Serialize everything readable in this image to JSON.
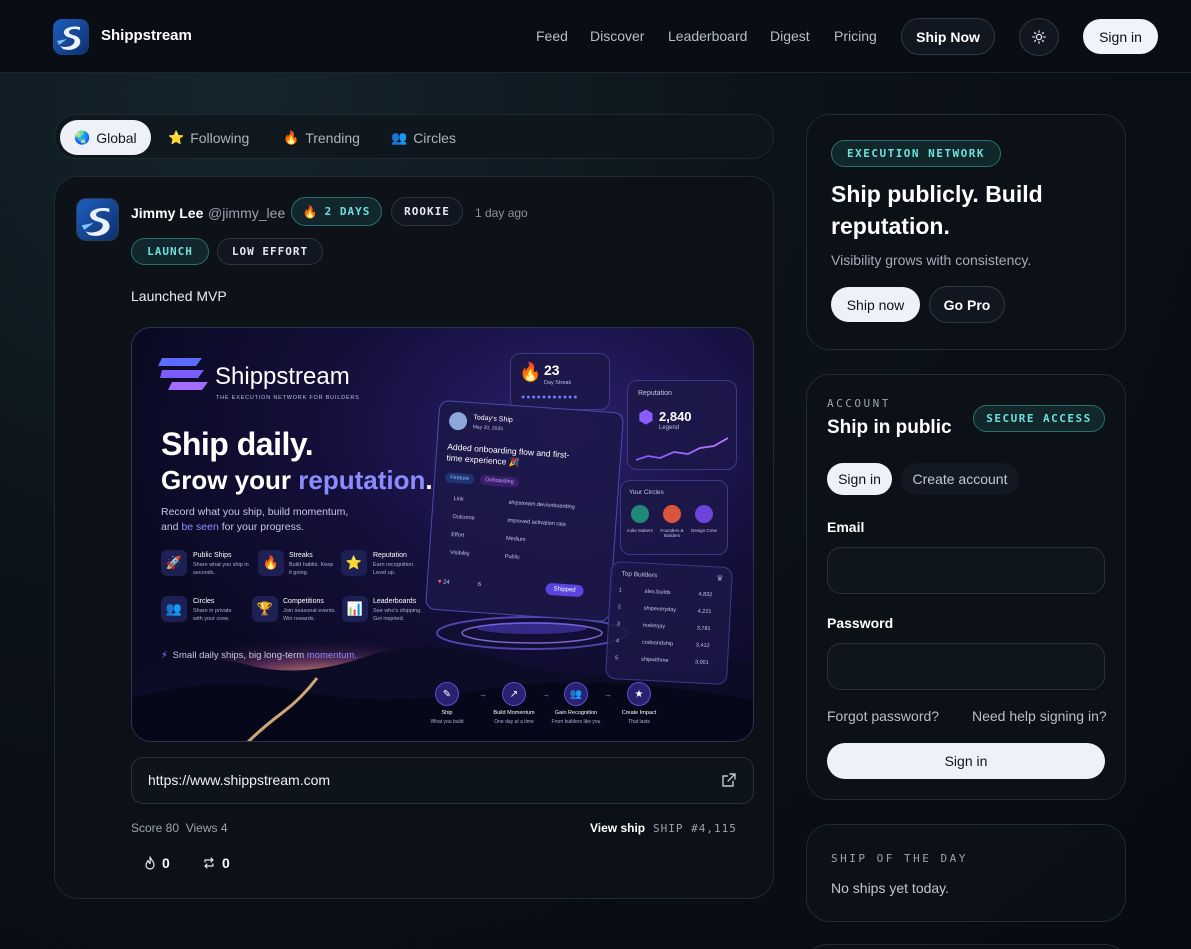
{
  "header": {
    "brand": "Shippstream",
    "nav": [
      "Feed",
      "Discover",
      "Leaderboard",
      "Digest",
      "Pricing"
    ],
    "ship_now": "Ship Now",
    "theme_icon": "sun-icon",
    "sign_in": "Sign in"
  },
  "feed_tabs": [
    {
      "label": "Global",
      "icon": "globe-icon",
      "active": true
    },
    {
      "label": "Following",
      "icon": "star-icon",
      "active": false
    },
    {
      "label": "Trending",
      "icon": "fire-icon",
      "active": false
    },
    {
      "label": "Circles",
      "icon": "people-icon",
      "active": false
    }
  ],
  "post": {
    "author": "Jimmy Lee",
    "handle": "@jimmy_lee",
    "streak": "2 DAYS",
    "rank": "ROOKIE",
    "time": "1 day ago",
    "tags": [
      "LAUNCH",
      "LOW EFFORT"
    ],
    "content": "Launched MVP",
    "preview": {
      "brand": "Shippstream",
      "tagline": "THE EXECUTION NETWORK FOR BUILDERS",
      "headline1": "Ship daily.",
      "headline2a": "Grow your ",
      "headline2b": "reputation",
      "headline2c": ".",
      "desc1": "Record what you ship, build momentum,",
      "desc2a": "and ",
      "desc2b": "be seen",
      "desc2c": " for your progress.",
      "features": [
        {
          "title": "Public Ships",
          "desc": "Share what you ship in seconds.",
          "icon": "rocket-icon"
        },
        {
          "title": "Streaks",
          "desc": "Build habits. Keep it going.",
          "icon": "fire-icon"
        },
        {
          "title": "Reputation",
          "desc": "Earn recognition. Level up.",
          "icon": "star-icon"
        },
        {
          "title": "Circles",
          "desc": "Share in private with your crew.",
          "icon": "people-icon"
        },
        {
          "title": "Competitions",
          "desc": "Join seasonal events. Win rewards.",
          "icon": "trophy-icon"
        },
        {
          "title": "Leaderboards",
          "desc": "See who's shipping. Get inspired.",
          "icon": "bar-chart-icon"
        }
      ],
      "footer_a": "Small daily ships, big long-term ",
      "footer_b": "momentum.",
      "streak_num": "23",
      "streak_label": "Day Streak",
      "reputation_label": "Reputation",
      "reputation_value": "2,840",
      "reputation_level": "Legend",
      "today_title": "Today's Ship",
      "today_date": "May 20, 2025",
      "today_text": "Added onboarding flow and first-time experience 🎉",
      "today_tags": [
        "Feature",
        "Onboarding"
      ],
      "today_rows": [
        {
          "k": "Link",
          "v": "shipstream.dev/onboarding"
        },
        {
          "k": "Outcome",
          "v": "Improved activation rate"
        },
        {
          "k": "Effort",
          "v": "Medium"
        },
        {
          "k": "Visibility",
          "v": "Public"
        }
      ],
      "today_likes": "24",
      "today_comments": "6",
      "today_status": "Shipped",
      "circles_title": "Your Circles",
      "circles": [
        "Indie Makers",
        "Founders & Builders",
        "Design Crew"
      ],
      "top_title": "Top Builders",
      "top_builders": [
        {
          "rank": "1",
          "name": "alex.builds",
          "score": "4,832"
        },
        {
          "rank": "2",
          "name": "shipeveryday",
          "score": "4,221"
        },
        {
          "rank": "3",
          "name": "makerjay",
          "score": "3,781"
        },
        {
          "rank": "4",
          "name": "codeandship",
          "score": "3,412"
        },
        {
          "rank": "5",
          "name": "shipwithme",
          "score": "3,001"
        }
      ],
      "steps": [
        {
          "title": "Ship",
          "desc": "What you build"
        },
        {
          "title": "Build Momentum",
          "desc": "One day at a time"
        },
        {
          "title": "Gain Recognition",
          "desc": "From builders like you"
        },
        {
          "title": "Create Impact",
          "desc": "That lasts"
        }
      ]
    },
    "url": "https://www.shippstream.com",
    "score": "Score 80",
    "views": "Views 4",
    "view_ship": "View ship",
    "ship_number": "SHIP #4,115",
    "fire_count": "0",
    "reship_count": "0"
  },
  "hero": {
    "badge": "EXECUTION NETWORK",
    "title": "Ship publicly. Build reputation.",
    "subtitle": "Visibility grows with consistency.",
    "ship_now": "Ship now",
    "go_pro": "Go Pro"
  },
  "account": {
    "eyebrow": "ACCOUNT",
    "title": "Ship in public",
    "badge": "SECURE ACCESS",
    "tab_signin": "Sign in",
    "tab_create": "Create account",
    "email_label": "Email",
    "password_label": "Password",
    "forgot": "Forgot password?",
    "help": "Need help signing in?",
    "submit": "Sign in"
  },
  "ship_of_day": {
    "eyebrow": "SHIP OF THE DAY",
    "empty": "No ships yet today."
  },
  "colors": {
    "accent_teal": "#6fe0dc",
    "accent_purple": "#8b7bff",
    "bg": "#0b1218"
  }
}
